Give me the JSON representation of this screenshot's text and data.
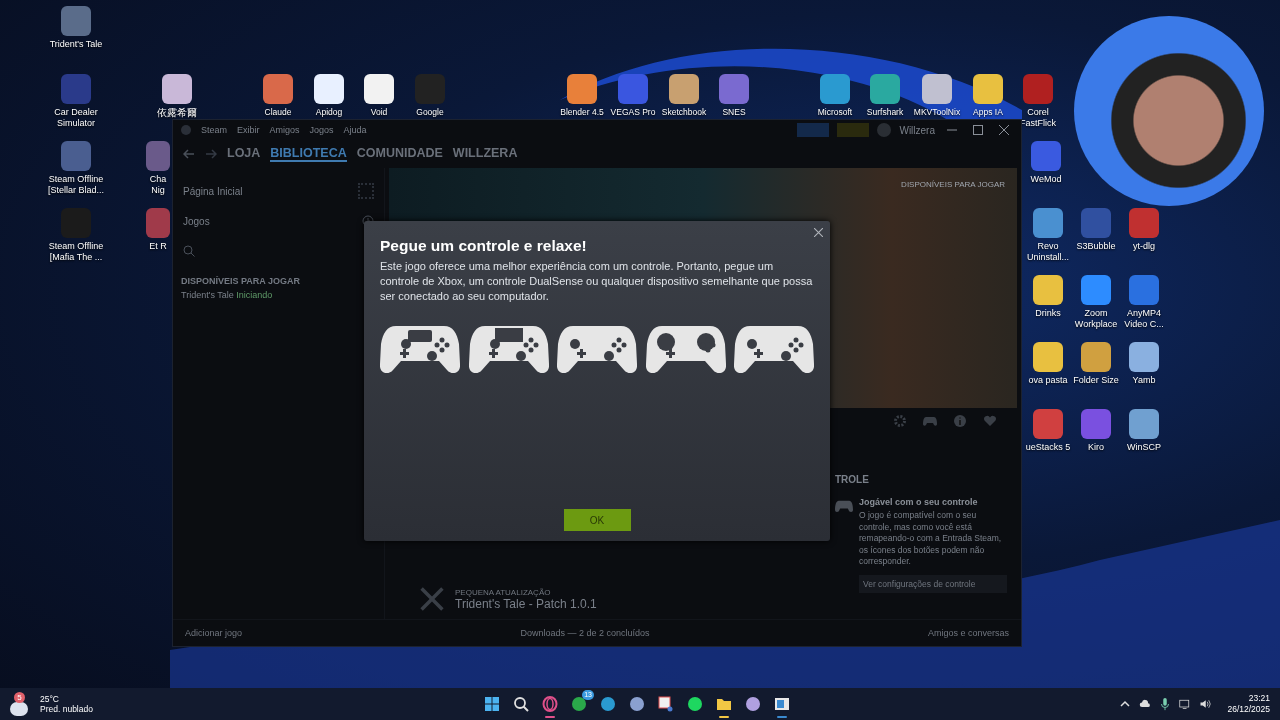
{
  "desktop_icons": [
    {
      "label": "Trident's Tale"
    },
    {
      "label": "Car Dealer Simulator"
    },
    {
      "label": "Steam Offline [Stellar Blad..."
    },
    {
      "label": "Steam Offline [Mafia The ..."
    },
    {
      "label": "依露希爾"
    },
    {
      "label": "Cha Nig"
    },
    {
      "label": "Et R"
    },
    {
      "label": "Claude"
    },
    {
      "label": "Apidog"
    },
    {
      "label": "Void"
    },
    {
      "label": "Google"
    },
    {
      "label": "Blender 4.5"
    },
    {
      "label": "VEGAS Pro"
    },
    {
      "label": "Sketchbook"
    },
    {
      "label": "SNES"
    },
    {
      "label": "Microsoft"
    },
    {
      "label": "Surfshark"
    },
    {
      "label": "MKVToolNix"
    },
    {
      "label": "Apps IA"
    },
    {
      "label": "Corel FastFlick"
    },
    {
      "label": "WeMod"
    },
    {
      "label": "Revo Uninstall..."
    },
    {
      "label": "S3Bubble"
    },
    {
      "label": "yt-dlg"
    },
    {
      "label": "Drinks"
    },
    {
      "label": "Zoom Workplace"
    },
    {
      "label": "AnyMP4 Video C..."
    },
    {
      "label": "ova pasta"
    },
    {
      "label": "Folder Size"
    },
    {
      "label": "Yamb"
    },
    {
      "label": "ueStacks 5"
    },
    {
      "label": "Kiro"
    },
    {
      "label": "WinSCP"
    }
  ],
  "steam_window": {
    "menu": [
      "Steam",
      "Exibir",
      "Amigos",
      "Jogos",
      "Ajuda"
    ],
    "user": "Willzera",
    "nav": [
      {
        "label": "LOJA",
        "selected": false
      },
      {
        "label": "BIBLIOTECA",
        "selected": true
      },
      {
        "label": "COMUNIDADE",
        "selected": false
      },
      {
        "label": "WILLZERA",
        "selected": false
      }
    ],
    "sidebar": {
      "home": "Página Inicial",
      "filter": "Jogos",
      "section": "DISPONÍVEIS PARA JOGAR",
      "games": [
        {
          "name": "Trident's Tale",
          "status": "Iniciando"
        }
      ]
    },
    "hero_label": "DISPONÍVEIS PARA JOGAR",
    "controller_section": {
      "heading": "TROLE",
      "title": "Jogável com o seu controle",
      "body": "O jogo é compatível com o seu controle, mas como você está remapeando-o com a Entrada Steam, os ícones dos botões podem não corresponder.",
      "link": "Ver configurações de controle"
    },
    "update": {
      "label": "PEQUENA ATUALIZAÇÃO",
      "title": "Trident's Tale - Patch 1.0.1"
    },
    "footer": {
      "add_game": "Adicionar jogo",
      "downloads": "Downloads — 2 de 2 concluídos",
      "friends": "Amigos e conversas"
    }
  },
  "dialog": {
    "title": "Pegue um controle e relaxe!",
    "body": "Este jogo oferece uma melhor experiência com um controle. Portanto, pegue um controle de Xbox, um controle DualSense ou qualquer dispositivo semelhante que possa ser conectado ao seu computador.",
    "ok": "OK"
  },
  "taskbar": {
    "weather": {
      "badge": "5",
      "temp": "25°C",
      "forecast": "Pred. nublado"
    },
    "apps": [
      {
        "kind": "start",
        "running": false
      },
      {
        "kind": "search",
        "running": false
      },
      {
        "kind": "opera",
        "running": true
      },
      {
        "kind": "xbox",
        "running": false,
        "badge": "13"
      },
      {
        "kind": "edge",
        "running": false
      },
      {
        "kind": "media",
        "running": false
      },
      {
        "kind": "snip",
        "running": false
      },
      {
        "kind": "spotify",
        "running": false
      },
      {
        "kind": "files",
        "running": true
      },
      {
        "kind": "swirl",
        "running": false
      },
      {
        "kind": "window",
        "running": true
      }
    ],
    "time": "23:21",
    "date": "26/12/2025"
  }
}
